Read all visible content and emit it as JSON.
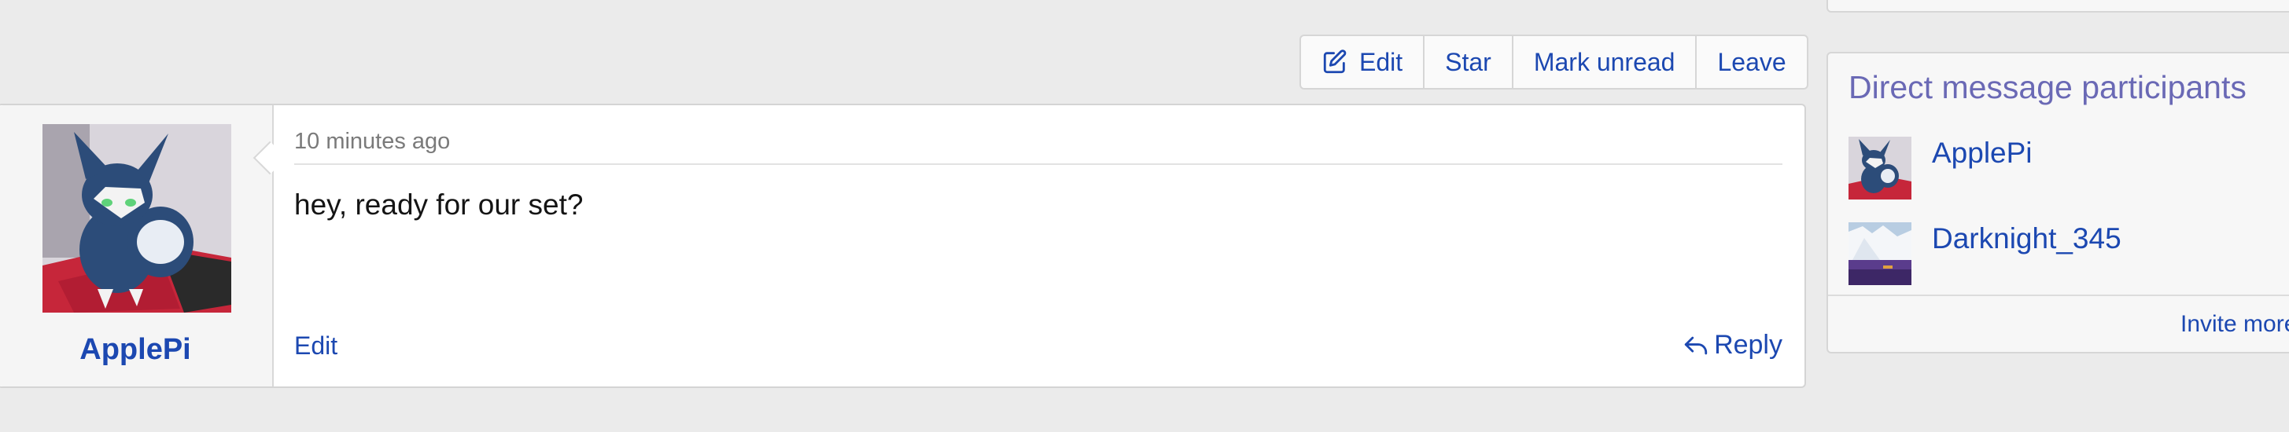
{
  "thread_actions": {
    "edit_label": "Edit",
    "star_label": "Star",
    "mark_unread_label": "Mark unread",
    "leave_label": "Leave"
  },
  "message": {
    "author": "ApplePi",
    "timestamp": "10 minutes ago",
    "body": "hey, ready for our set?",
    "edit_label": "Edit",
    "reply_label": "Reply"
  },
  "sidebar": {
    "participants_title": "Direct message participants",
    "participants": [
      {
        "name": "ApplePi",
        "avatar": "meowstic-avatar"
      },
      {
        "name": "Darknight_345",
        "avatar": "iceberg-avatar"
      }
    ],
    "invite_more_label": "Invite more"
  },
  "colors": {
    "link": "#1c48b1",
    "sidebar_title": "#6a69b5",
    "page_background": "#ebebeb",
    "muted_text": "#7a7a7a"
  },
  "icons": {
    "edit": "pencil-square-icon",
    "reply": "reply-arrow-icon"
  }
}
